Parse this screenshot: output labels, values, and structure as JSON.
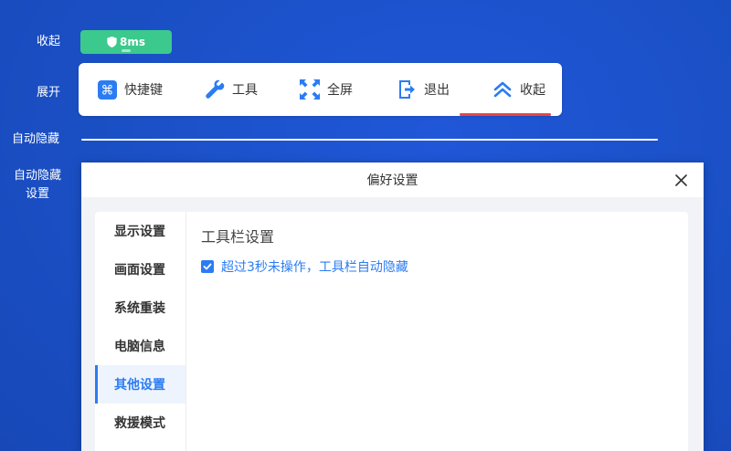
{
  "side_labels": {
    "collapse": "收起",
    "expand": "展开",
    "auto_hide": "自动隐藏",
    "auto_hide_settings_line1": "自动隐藏",
    "auto_hide_settings_line2": "设置"
  },
  "latency": {
    "value": "8ms",
    "color": "#3cc98d",
    "icon": "shield-icon"
  },
  "toolbar": {
    "items": [
      {
        "label": "快捷键",
        "icon": "command-key-icon"
      },
      {
        "label": "工具",
        "icon": "wrench-icon"
      },
      {
        "label": "全屏",
        "icon": "fullscreen-arrows-icon"
      },
      {
        "label": "退出",
        "icon": "exit-icon"
      },
      {
        "label": "收起",
        "icon": "double-chevron-up-icon"
      }
    ],
    "accent": "#2b7cf3"
  },
  "dialog": {
    "title": "偏好设置",
    "nav": [
      {
        "label": "显示设置",
        "active": false
      },
      {
        "label": "画面设置",
        "active": false
      },
      {
        "label": "系统重装",
        "active": false
      },
      {
        "label": "电脑信息",
        "active": false
      },
      {
        "label": "其他设置",
        "active": true
      },
      {
        "label": "救援模式",
        "active": false
      }
    ],
    "section_title": "工具栏设置",
    "option_label": "超过3秒未操作，工具栏自动隐藏",
    "option_checked": true
  }
}
